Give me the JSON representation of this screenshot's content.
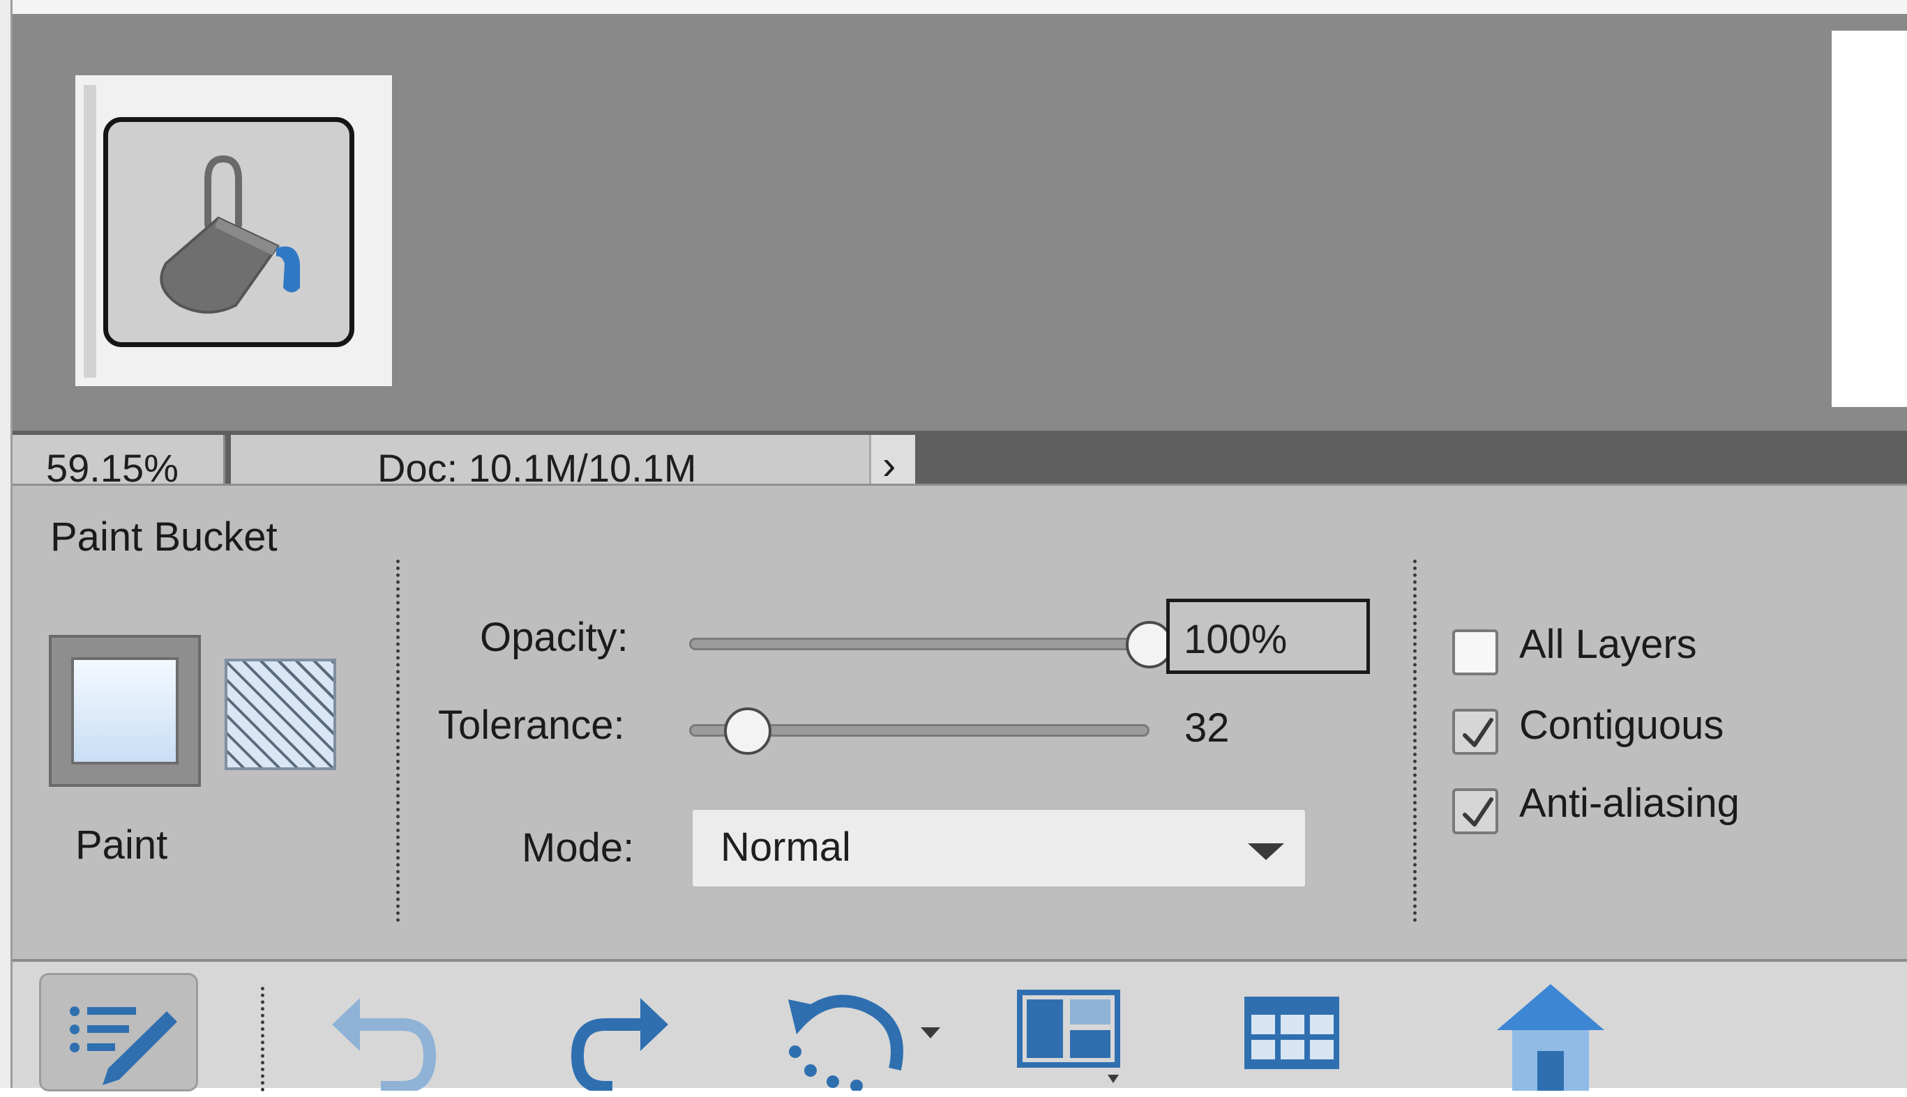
{
  "status": {
    "zoom": "59.15%",
    "doc_info": "Doc: 10.1M/10.1M",
    "expand_glyph": "›"
  },
  "tool": {
    "name": "Paint Bucket",
    "icon": "paint-bucket-icon"
  },
  "fill": {
    "paint_label": "Paint",
    "selected": "paint"
  },
  "opacity": {
    "label": "Opacity:",
    "value": "100%",
    "level": 1.0
  },
  "tolerance": {
    "label": "Tolerance:",
    "value": "32",
    "level": 0.128
  },
  "mode": {
    "label": "Mode:",
    "value": "Normal"
  },
  "checkboxes": [
    {
      "label": "All Layers",
      "checked": false
    },
    {
      "label": "Contiguous",
      "checked": true
    },
    {
      "label": "Anti-aliasing",
      "checked": true
    }
  ],
  "taskbar": {
    "icons": [
      "tool-options-icon",
      "undo-icon",
      "redo-icon",
      "rotate-icon",
      "layout-icon",
      "organizer-icon",
      "home-icon"
    ],
    "active": "tool-options-icon",
    "accent": "#2f6fb0"
  }
}
